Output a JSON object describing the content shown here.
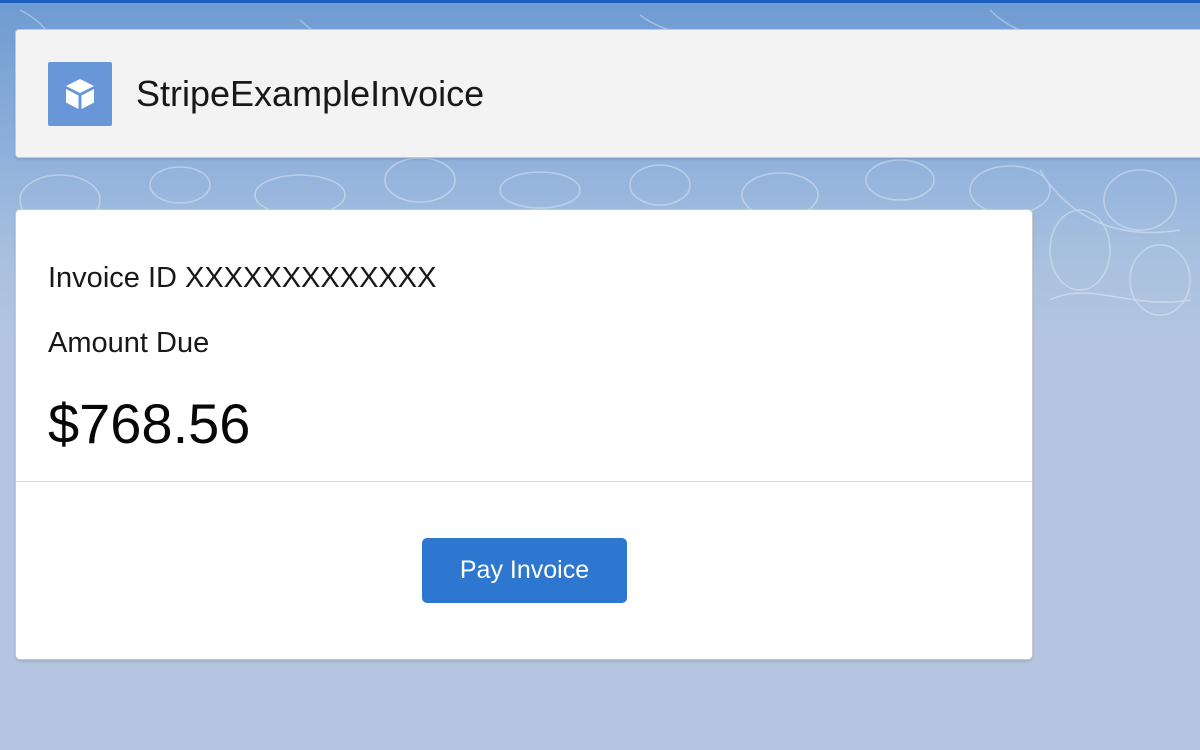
{
  "colors": {
    "accent": "#2e77d0",
    "app_icon_bg": "#6797d9",
    "top_strip": "#1b5fbf",
    "background": "#b3c5e0"
  },
  "header": {
    "icon": "cube-icon",
    "title": "StripeExampleInvoice"
  },
  "invoice": {
    "id_text": "Invoice ID XXXXXXXXXXXXX",
    "amount_label": "Amount Due",
    "amount_value": "$768.56",
    "pay_button_label": "Pay Invoice"
  }
}
